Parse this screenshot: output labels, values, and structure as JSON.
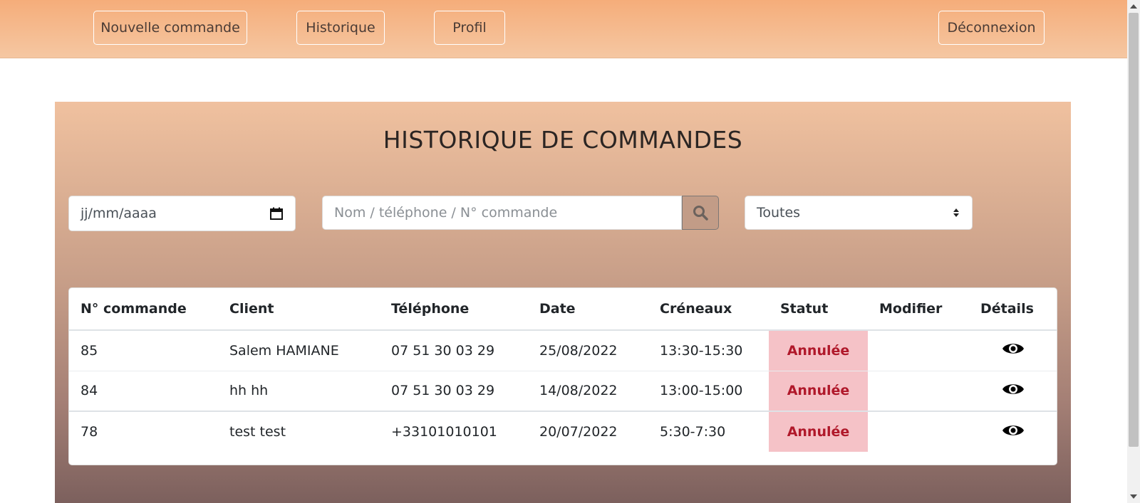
{
  "nav": {
    "new_order": "Nouvelle commande",
    "history": "Historique",
    "profile": "Profil",
    "logout": "Déconnexion"
  },
  "page": {
    "title": "HISTORIQUE DE COMMANDES"
  },
  "filters": {
    "date_placeholder": "jj/mm/aaaa",
    "search_placeholder": "Nom / téléphone / N° commande",
    "status_selected": "Toutes"
  },
  "table": {
    "headers": [
      "N° commande",
      "Client",
      "Téléphone",
      "Date",
      "Créneaux",
      "Statut",
      "Modifier",
      "Détails"
    ],
    "rows": [
      {
        "order": "85",
        "client": "Salem HAMIANE",
        "phone": "07 51 30 03 29",
        "date": "25/08/2022",
        "slot": "13:30-15:30",
        "status": "Annulée",
        "modify": ""
      },
      {
        "order": "84",
        "client": "hh hh",
        "phone": "07 51 30 03 29",
        "date": "14/08/2022",
        "slot": "13:00-15:00",
        "status": "Annulée",
        "modify": ""
      },
      {
        "order": "78",
        "client": "test test",
        "phone": "+33101010101",
        "date": "20/07/2022",
        "slot": "5:30-7:30",
        "status": "Annulée",
        "modify": ""
      }
    ]
  },
  "icons": {
    "calendar": "calendar-icon",
    "search": "search-icon",
    "select_arrows": "sort-arrows-icon",
    "details": "eye-icon"
  },
  "colors": {
    "nav_gradient_top": "#f5ad7a",
    "status_cancelled_bg": "#f5c2c7",
    "status_cancelled_text": "#b0182a"
  }
}
